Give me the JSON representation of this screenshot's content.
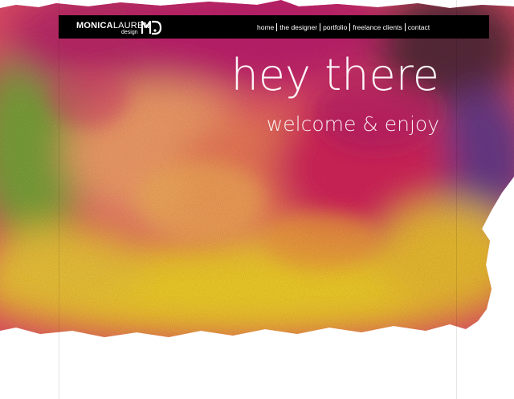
{
  "brand": {
    "name_first": "MONICA",
    "name_last": "LAUREN",
    "tagline": "design",
    "mark": "MD"
  },
  "nav": {
    "items": [
      {
        "label": "home"
      },
      {
        "label": "the designer"
      },
      {
        "label": "portfolio"
      },
      {
        "label": "freelance clients"
      },
      {
        "label": "contact"
      }
    ]
  },
  "hero": {
    "title": "hey there",
    "subtitle": "welcome & enjoy"
  },
  "colors": {
    "header_bg": "#000000",
    "header_text": "#ffffff",
    "hero_text": "#ffffff",
    "watercolor_magenta": "#d0266e",
    "watercolor_orange": "#f48a4a",
    "watercolor_yellow": "#f6d12a",
    "watercolor_green": "#7ea43a",
    "watercolor_purple": "#6a3a8a",
    "page_bg": "#ffffff"
  },
  "icons": {
    "logo_mark": "md-monogram-icon"
  }
}
